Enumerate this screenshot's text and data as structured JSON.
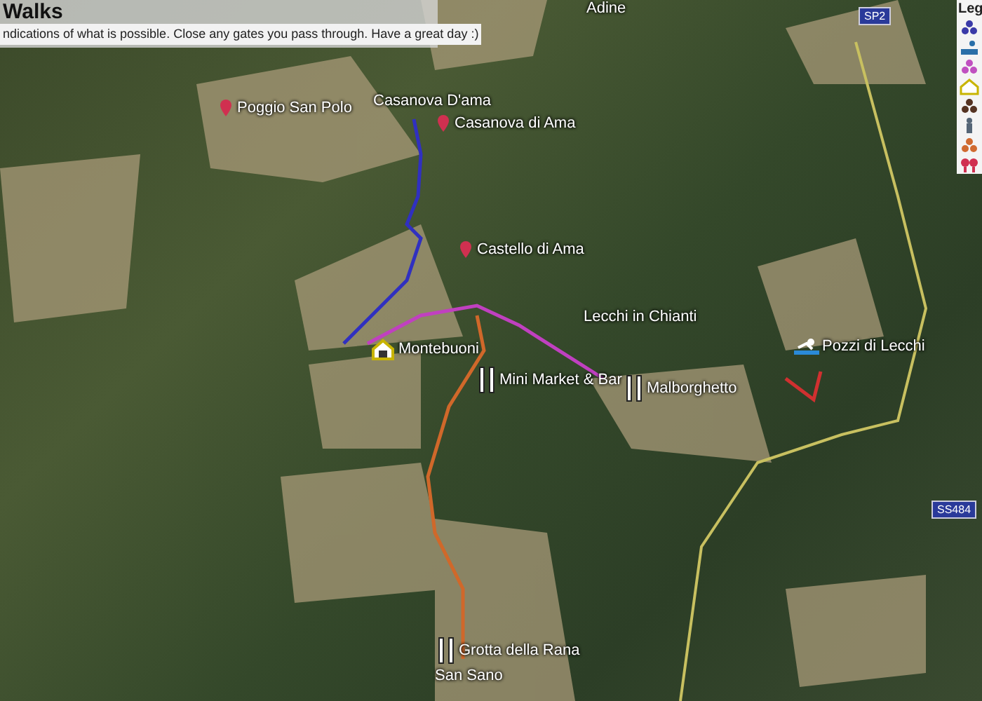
{
  "header": {
    "title": "Walks",
    "description": "ndications of what is possible. Close any gates you pass through. Have a great day :)"
  },
  "map_labels": [
    {
      "text": "Adine",
      "kind": "none"
    },
    {
      "text": "Poggio San Polo",
      "kind": "pin"
    },
    {
      "text": "Casanova D'ama",
      "kind": "none"
    },
    {
      "text": "Casanova di Ama",
      "kind": "pin"
    },
    {
      "text": "Castello di Ama",
      "kind": "pin"
    },
    {
      "text": "Lecchi in Chianti",
      "kind": "none"
    },
    {
      "text": "Montebuoni",
      "kind": "house"
    },
    {
      "text": "Mini Market & Bar",
      "kind": "food"
    },
    {
      "text": "Malborghetto",
      "kind": "food"
    },
    {
      "text": "Pozzi di Lecchi",
      "kind": "swim"
    },
    {
      "text": "Grotta della Rana",
      "kind": "food"
    },
    {
      "text": "San Sano",
      "kind": "none"
    }
  ],
  "road_signs": [
    "SP2",
    "SS484"
  ],
  "legend": {
    "title": "Leg",
    "items": [
      {
        "kind": "dots",
        "color": "#3a3aa8"
      },
      {
        "kind": "swim",
        "color": "#2a6fa8"
      },
      {
        "kind": "dots",
        "color": "#c050c0"
      },
      {
        "kind": "house",
        "color": "#c8b400"
      },
      {
        "kind": "dots",
        "color": "#553322"
      },
      {
        "kind": "person",
        "color": "#556677"
      },
      {
        "kind": "dots",
        "color": "#d06a30"
      },
      {
        "kind": "food",
        "color": "#d03050"
      }
    ]
  }
}
